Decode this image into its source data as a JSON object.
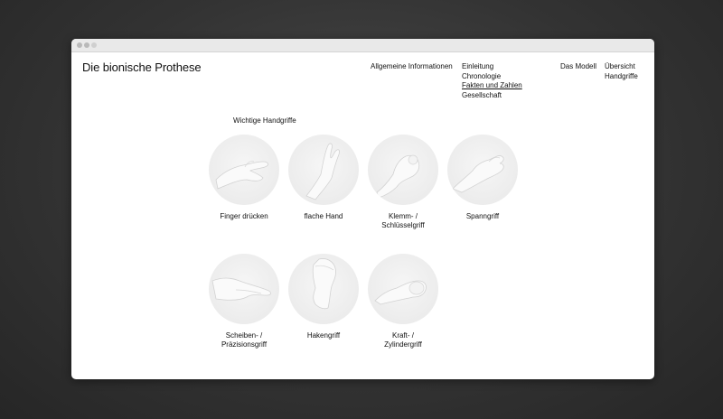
{
  "site": {
    "title": "Die bionische Prothese"
  },
  "nav": {
    "general": "Allgemeine Informationen",
    "sub_items": [
      {
        "label": "Einleitung",
        "active": false
      },
      {
        "label": "Chronologie",
        "active": false
      },
      {
        "label": "Fakten und Zahlen",
        "active": true
      },
      {
        "label": "Gesellschaft",
        "active": false
      }
    ],
    "model": "Das Modell",
    "overview_line1": "Übersicht",
    "overview_line2": "Handgriffe"
  },
  "section": {
    "title": "Wichtige Handgriffe"
  },
  "grips": [
    {
      "label": "Finger drücken",
      "icon": "pinch-hand-icon"
    },
    {
      "label": "flache Hand",
      "icon": "flat-hand-icon"
    },
    {
      "label": "Klemm- /\nSchlüsselgriff",
      "icon": "key-grip-hand-icon"
    },
    {
      "label": "Spanngriff",
      "icon": "span-grip-hand-icon"
    },
    {
      "label": "Scheiben- /\nPräzisionsgriff",
      "icon": "disc-grip-hand-icon"
    },
    {
      "label": "Hakengriff",
      "icon": "hook-grip-hand-icon"
    },
    {
      "label": "Kraft- /\nZylindergriff",
      "icon": "cylinder-grip-hand-icon"
    }
  ],
  "colors": {
    "background": "#333333",
    "page": "#ffffff",
    "circle": "#ececec",
    "text": "#111111"
  }
}
